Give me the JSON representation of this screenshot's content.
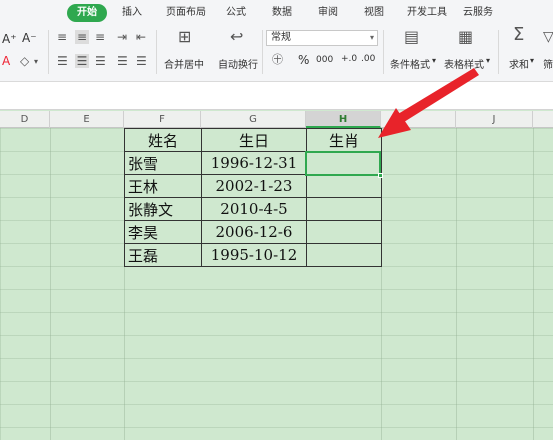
{
  "menu": {
    "tabs": [
      {
        "label": "开始",
        "active": true
      },
      {
        "label": "插入"
      },
      {
        "label": "页面布局"
      },
      {
        "label": "公式"
      },
      {
        "label": "数据"
      },
      {
        "label": "审阅"
      },
      {
        "label": "视图"
      },
      {
        "label": "开发工具"
      },
      {
        "label": "云服务"
      }
    ]
  },
  "ribbon": {
    "font_size_fragment": "A⁺",
    "font_color_fragment": "A",
    "merge_label": "合并居中",
    "wrap_label": "自动换行",
    "number_format": "常规",
    "percent_symbol": "%",
    "thousands_symbol": "000",
    "inc_decimal": "+.0",
    "dec_decimal": ".00",
    "cond_format_label": "条件格式",
    "table_style_label": "表格样式",
    "sum_label": "求和",
    "filter_label": "筛"
  },
  "columns": [
    "D",
    "E",
    "F",
    "G",
    "H",
    "J"
  ],
  "selected_column": "H",
  "table": {
    "headers": [
      "姓名",
      "生日",
      "生肖"
    ],
    "rows": [
      [
        "张雪",
        "1996-12-31",
        ""
      ],
      [
        "王林",
        "2002-1-23",
        ""
      ],
      [
        "张静文",
        "2010-4-5",
        ""
      ],
      [
        "李昊",
        "2006-12-6",
        ""
      ],
      [
        "王磊",
        "1995-10-12",
        ""
      ]
    ]
  },
  "colors": {
    "accent": "#2fa84f",
    "grid_bg": "#cfe8cf",
    "arrow": "#e8232a"
  }
}
